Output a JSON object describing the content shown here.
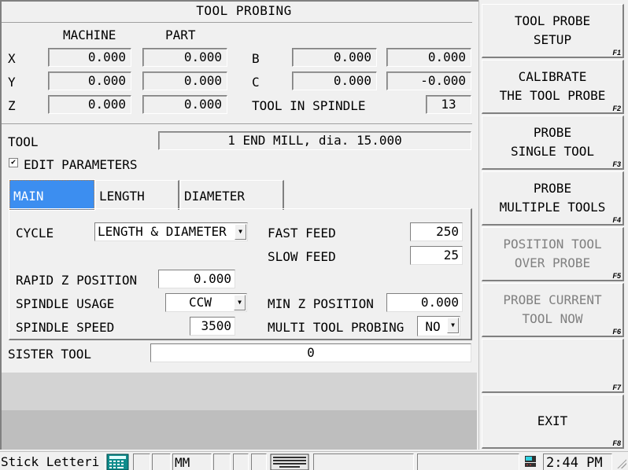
{
  "window": {
    "title": "TOOL PROBING"
  },
  "coordinates": {
    "col_machine": "MACHINE",
    "col_part": "PART",
    "rows": [
      {
        "axis": "X",
        "machine": "0.000",
        "part": "0.000"
      },
      {
        "axis": "Y",
        "machine": "0.000",
        "part": "0.000"
      },
      {
        "axis": "Z",
        "machine": "0.000",
        "part": "0.000"
      }
    ],
    "rotary": [
      {
        "axis": "B",
        "machine": "0.000",
        "part": "0.000"
      },
      {
        "axis": "C",
        "machine": "0.000",
        "part": "-0.000"
      }
    ],
    "tool_in_spindle_label": "TOOL IN SPINDLE",
    "tool_in_spindle": "13"
  },
  "tool": {
    "label": "TOOL",
    "value": "1 END MILL, dia. 15.000"
  },
  "edit_parameters": {
    "label": "EDIT PARAMETERS",
    "checked": true,
    "check_glyph": "✔"
  },
  "tabs": [
    {
      "label": "MAIN",
      "active": true
    },
    {
      "label": "LENGTH",
      "active": false
    },
    {
      "label": "DIAMETER",
      "active": false
    }
  ],
  "main_tab": {
    "cycle_label": "CYCLE",
    "cycle_value": "LENGTH & DIAMETER",
    "fast_feed_label": "FAST FEED",
    "fast_feed": "250",
    "slow_feed_label": "SLOW FEED",
    "slow_feed": "25",
    "rapid_z_label": "RAPID Z POSITION",
    "rapid_z": "0.000",
    "spindle_usage_label": "SPINDLE USAGE",
    "spindle_usage": "CCW",
    "min_z_label": "MIN Z POSITION",
    "min_z": "0.000",
    "spindle_speed_label": "SPINDLE SPEED",
    "spindle_speed": "3500",
    "multi_tool_label": "MULTI TOOL PROBING",
    "multi_tool": "NO",
    "dropdown_arrow": "▼"
  },
  "sister_tool": {
    "label": "SISTER TOOL",
    "value": "0"
  },
  "function_keys": [
    {
      "line1": "TOOL PROBE",
      "line2": "SETUP",
      "key": "F1",
      "enabled": true
    },
    {
      "line1": "CALIBRATE",
      "line2": "THE TOOL PROBE",
      "key": "F2",
      "enabled": true
    },
    {
      "line1": "PROBE",
      "line2": "SINGLE TOOL",
      "key": "F3",
      "enabled": true
    },
    {
      "line1": "PROBE",
      "line2": "MULTIPLE TOOLS",
      "key": "F4",
      "enabled": true
    },
    {
      "line1": "POSITION TOOL",
      "line2": "OVER PROBE",
      "key": "F5",
      "enabled": false
    },
    {
      "line1": "PROBE CURRENT",
      "line2": "TOOL NOW",
      "key": "F6",
      "enabled": false
    },
    {
      "line1": "",
      "line2": "",
      "key": "F7",
      "enabled": true
    },
    {
      "line1": "EXIT",
      "line2": "",
      "key": "F8",
      "enabled": true
    }
  ],
  "statusbar": {
    "mode_text": "Stick Letteri",
    "units": "MM",
    "time": "2:44 PM"
  },
  "colors": {
    "active_tab": "#3c8ef0",
    "background": "#f0f0f0",
    "disabled_text": "#808080"
  }
}
